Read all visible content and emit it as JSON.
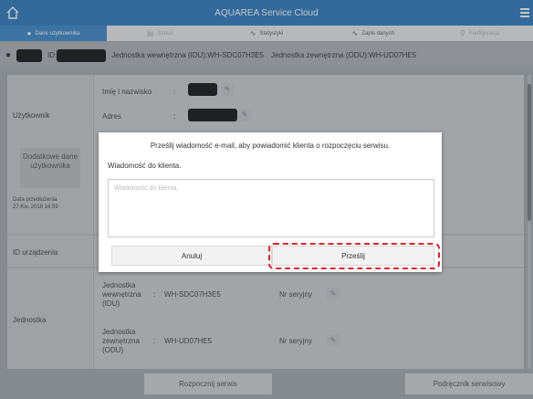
{
  "app": {
    "title": "AQUAREA Service Cloud"
  },
  "tabs": [
    {
      "label": "Dane użytkownika",
      "icon": "user-icon"
    },
    {
      "label": "Status",
      "icon": "status-icon"
    },
    {
      "label": "Statystyki",
      "icon": "statistics-icon"
    },
    {
      "label": "Zapis danych",
      "icon": "data-log-icon"
    },
    {
      "label": "Konfiguracja",
      "icon": "key-icon"
    }
  ],
  "id_row": {
    "id_label": "ID:",
    "idu": "Jednostka wewnętrzna (IDU):WH-SDC07H3E5",
    "odu": "Jednostka zewnętrzna (ODU):WH-UD07HE5"
  },
  "user_section": {
    "title": "Użytkownik",
    "name_label": "Imię i nazwisko",
    "address_label": "Adres",
    "separator": ":"
  },
  "extra_data": {
    "button_label": "Dodatkowe dane użytkownika",
    "date_label": "Data przedłużenia",
    "date_value": "27.Kw..2018 16:59"
  },
  "device_section": {
    "title": "ID urządzenia"
  },
  "units_section": {
    "title": "Jednostka",
    "units": [
      {
        "label": "Jednostka wewnętrzna (IDU)",
        "model": "WH-SDC07H3E5",
        "serial_label": "Nr seryjny"
      },
      {
        "label": "Jednostka zewnętrzna (ODU)",
        "model": "WH-UD07HE5",
        "serial_label": "Nr seryjny"
      }
    ]
  },
  "bottom": {
    "start_service": "Rozpocznij serwis",
    "service_manual": "Podręcznik serwisowy"
  },
  "dialog": {
    "message": "Prześlij wiadomość e-mail, aby powiadomić klienta o rozpoczęciu serwisu.",
    "sub_label": "Wiadomość do klienta.",
    "textarea_placeholder": "Wiadomość do klienta.",
    "cancel_label": "Anuluj",
    "send_label": "Prześlij"
  },
  "colors": {
    "header": "#1e70b8",
    "active_tab": "#2d7fc4",
    "highlight": "#e8202a"
  }
}
